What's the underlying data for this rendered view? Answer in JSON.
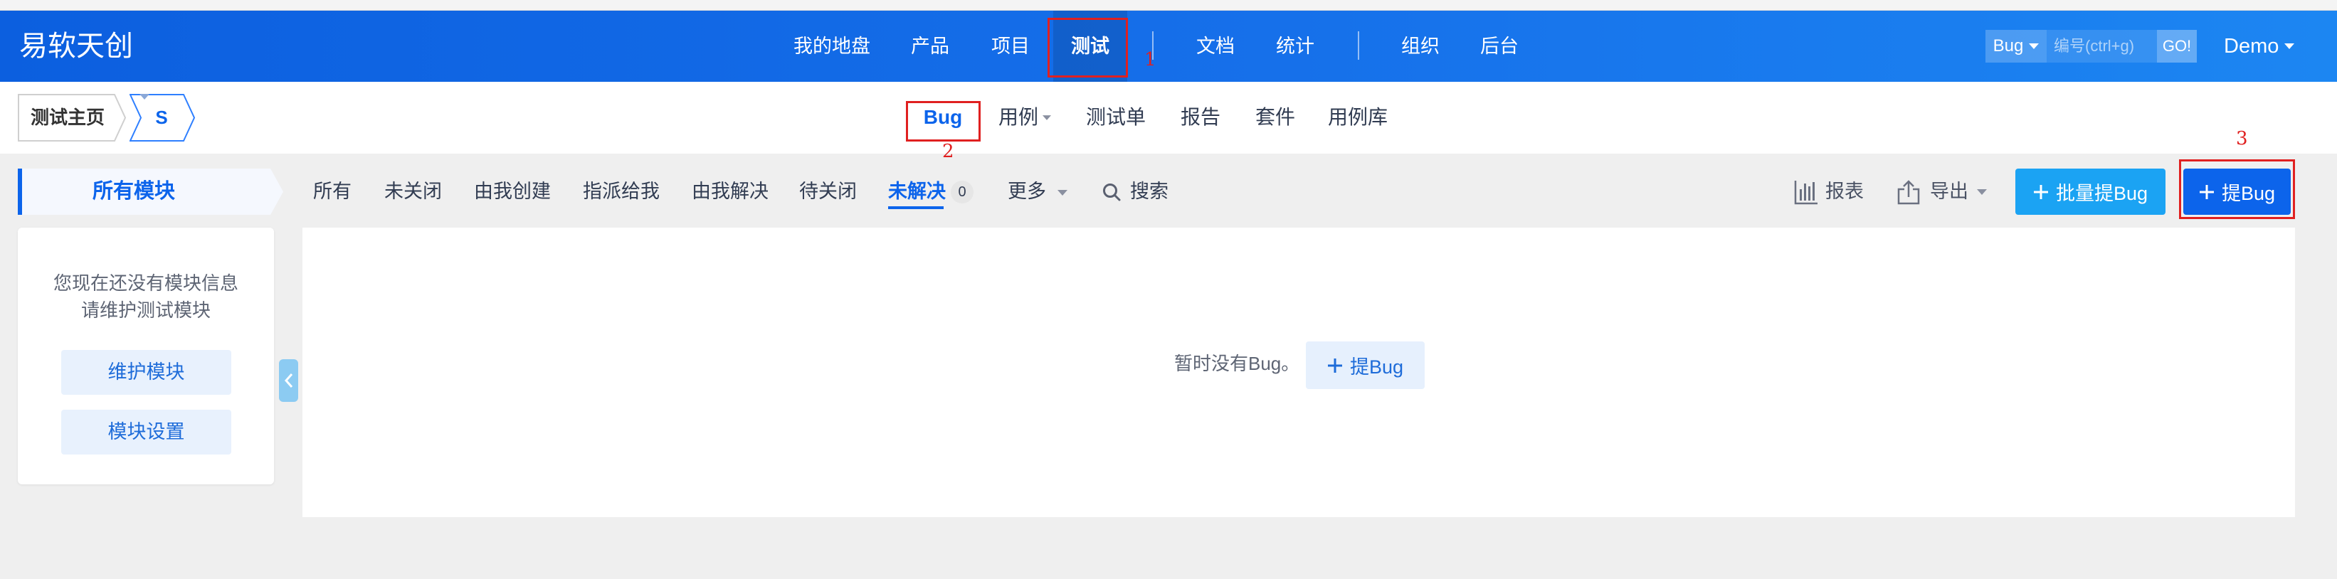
{
  "app": {
    "logo": "易软天创"
  },
  "header": {
    "nav": [
      {
        "label": "我的地盘"
      },
      {
        "label": "产品"
      },
      {
        "label": "项目"
      },
      {
        "label": "测试",
        "active": true
      },
      {
        "label": "文档"
      },
      {
        "label": "统计"
      },
      {
        "label": "组织"
      },
      {
        "label": "后台"
      }
    ],
    "search": {
      "type": "Bug",
      "placeholder": "编号(ctrl+g)",
      "go": "GO!"
    },
    "user": "Demo"
  },
  "subnav": {
    "breadcrumb": {
      "home": "测试主页",
      "product": "S"
    },
    "tabs": [
      {
        "label": "Bug",
        "active": true
      },
      {
        "label": "用例",
        "has_dropdown": true
      },
      {
        "label": "测试单"
      },
      {
        "label": "报告"
      },
      {
        "label": "套件"
      },
      {
        "label": "用例库"
      }
    ]
  },
  "module_tree": {
    "tab": "所有模块",
    "empty_line1": "您现在还没有模块信息",
    "empty_line2": "请维护测试模块",
    "maintain_button": "维护模块",
    "settings_button": "模块设置"
  },
  "filters": {
    "items": [
      {
        "label": "所有"
      },
      {
        "label": "未关闭"
      },
      {
        "label": "由我创建"
      },
      {
        "label": "指派给我"
      },
      {
        "label": "由我解决"
      },
      {
        "label": "待关闭"
      },
      {
        "label": "未解决",
        "active": true,
        "count": "0"
      },
      {
        "label": "更多",
        "has_dropdown": true
      }
    ],
    "search": "搜索"
  },
  "toolbar": {
    "report": "报表",
    "export": "导出",
    "batch_create": "批量提Bug",
    "create": "提Bug"
  },
  "content": {
    "empty_text": "暂时没有Bug。",
    "create_button": "提Bug"
  },
  "annotations": [
    {
      "label": "1"
    },
    {
      "label": "2"
    },
    {
      "label": "3"
    }
  ],
  "icons": {
    "caret": "caret-down-icon",
    "search": "search-icon",
    "report": "bar-chart-icon",
    "export": "export-icon",
    "plus": "plus-icon",
    "collapse": "chevron-left-icon"
  },
  "colors": {
    "header_start": "#0c5fdf",
    "header_end": "#1c86f2",
    "accent": "#0c64eb",
    "batch_button": "#1ba3f3",
    "annotation": "#e02020",
    "page_background": "#efefef"
  }
}
